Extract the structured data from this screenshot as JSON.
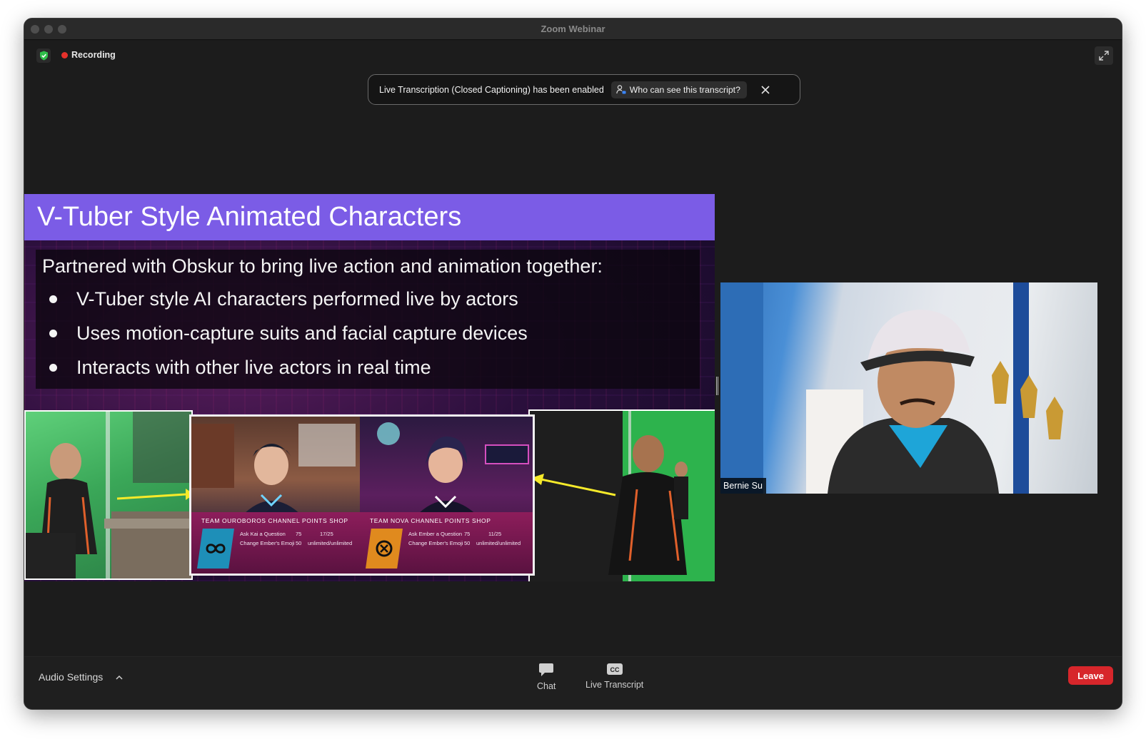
{
  "window": {
    "title": "Zoom Webinar"
  },
  "status": {
    "recording_label": "Recording"
  },
  "banner": {
    "message": "Live Transcription (Closed Captioning) has been enabled",
    "who_button": "Who can see this transcript?"
  },
  "slide": {
    "title": "V-Tuber Style Animated Characters",
    "intro": "Partnered with Obskur to bring live action and animation together:",
    "bullets": [
      "V-Tuber style AI characters performed live by actors",
      "Uses motion-capture suits and facial capture devices",
      "Interacts with other live actors in real time"
    ],
    "shop_left": {
      "title": "TEAM OUROBOROS CHANNEL POINTS SHOP",
      "rows": [
        {
          "item": "Ask Kai a Question",
          "cost": "75",
          "limit": "17/25"
        },
        {
          "item": "Change Ember's Emoji",
          "cost": "50",
          "limit": "unlimited/unlimited"
        }
      ]
    },
    "shop_right": {
      "title": "TEAM NOVA CHANNEL POINTS SHOP",
      "rows": [
        {
          "item": "Ask Ember a Question",
          "cost": "75",
          "limit": "11/25"
        },
        {
          "item": "Change Ember's Emoji",
          "cost": "50",
          "limit": "unlimited/unlimited"
        }
      ]
    }
  },
  "speaker": {
    "name": "Bernie Su"
  },
  "toolbar": {
    "audio_settings": "Audio Settings",
    "chat": "Chat",
    "live_transcript": "Live Transcript",
    "leave": "Leave"
  },
  "colors": {
    "slide_header": "#7b5ce6",
    "leave_button": "#d7262b",
    "recording_dot": "#e5312b",
    "shield": "#2fbf4a"
  }
}
